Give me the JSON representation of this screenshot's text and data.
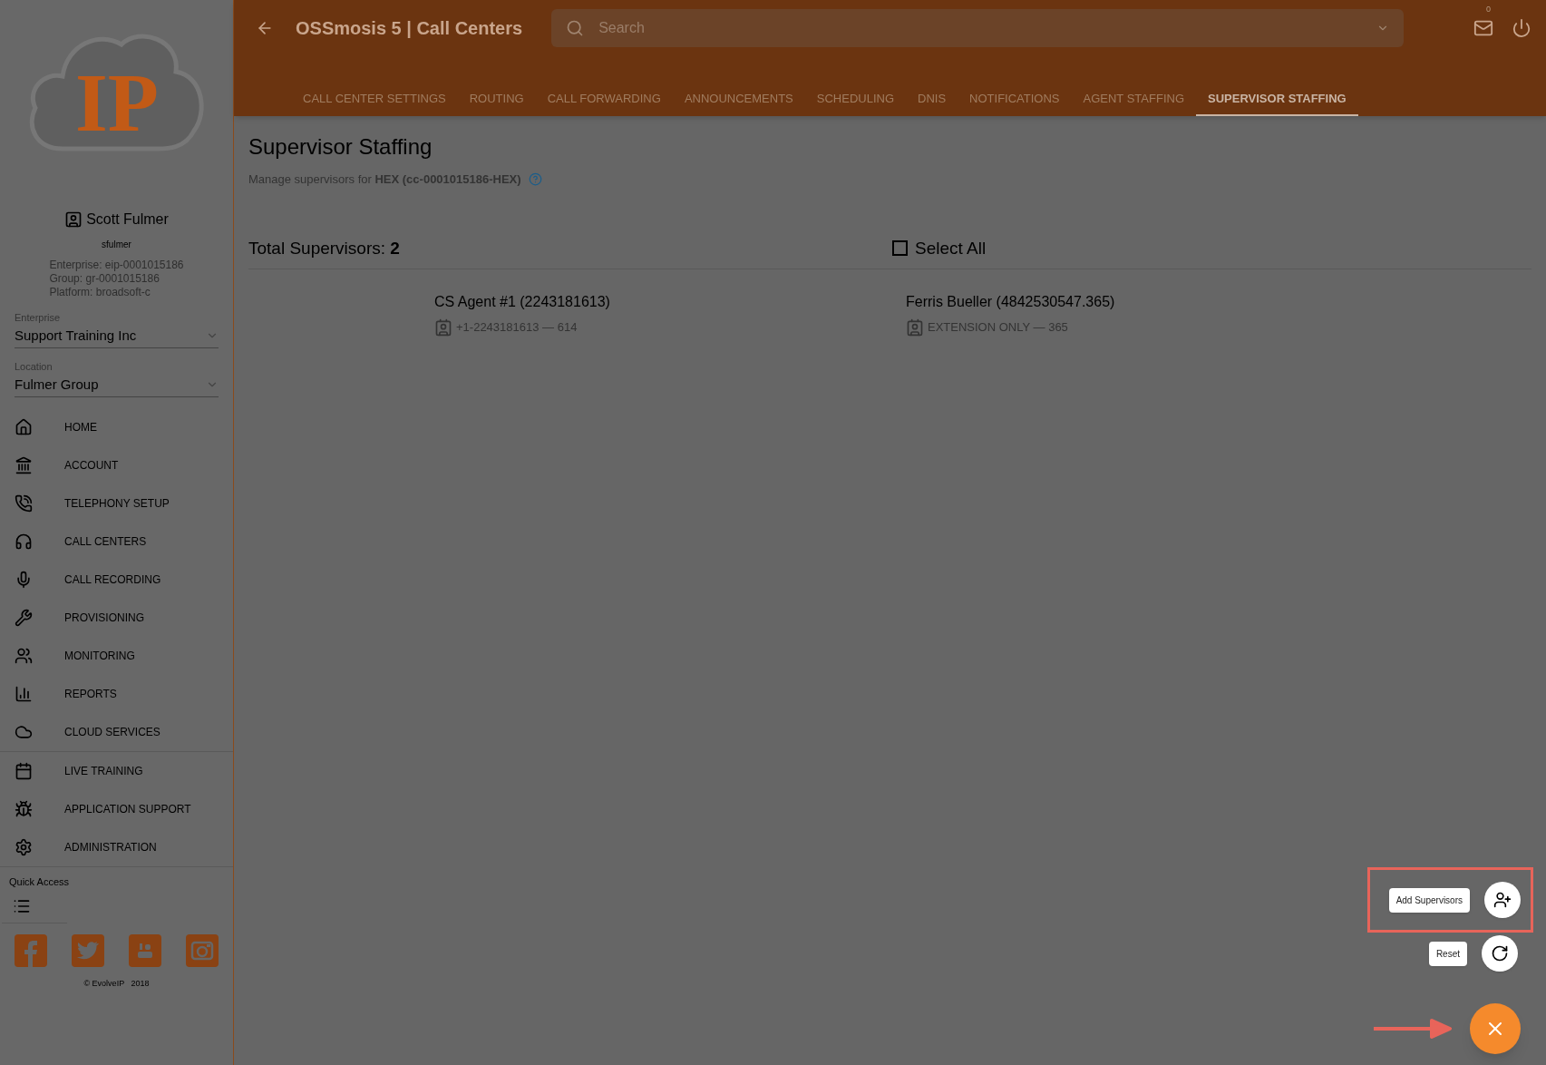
{
  "logo": {
    "text": "IP"
  },
  "user": {
    "name": "Scott Fulmer",
    "username": "sfulmer",
    "details": [
      "Enterprise: eip-0001015186",
      "Group: gr-0001015186",
      "Platform: broadsoft-c"
    ]
  },
  "selects": [
    {
      "label": "Enterprise",
      "value": "Support Training Inc"
    },
    {
      "label": "Location",
      "value": "Fulmer Group"
    }
  ],
  "nav": [
    {
      "label": "HOME"
    },
    {
      "label": "ACCOUNT"
    },
    {
      "label": "TELEPHONY SETUP"
    },
    {
      "label": "CALL CENTERS"
    },
    {
      "label": "CALL RECORDING"
    },
    {
      "label": "PROVISIONING"
    },
    {
      "label": "MONITORING"
    },
    {
      "label": "REPORTS"
    },
    {
      "label": "CLOUD SERVICES"
    },
    {
      "label": "LIVE TRAINING"
    },
    {
      "label": "APPLICATION SUPPORT"
    },
    {
      "label": "ADMINISTRATION"
    }
  ],
  "quick_access": {
    "label": "Quick Access"
  },
  "footer": {
    "copyright": "© EvolveIP   2018"
  },
  "header": {
    "title": "OSSmosis 5 | Call Centers",
    "search_placeholder": "Search",
    "mail_badge": "0"
  },
  "tabs": [
    {
      "label": "CALL CENTER SETTINGS",
      "selected": false
    },
    {
      "label": "ROUTING",
      "selected": false
    },
    {
      "label": "CALL FORWARDING",
      "selected": false
    },
    {
      "label": "ANNOUNCEMENTS",
      "selected": false
    },
    {
      "label": "SCHEDULING",
      "selected": false
    },
    {
      "label": "DNIS",
      "selected": false
    },
    {
      "label": "NOTIFICATIONS",
      "selected": false
    },
    {
      "label": "AGENT STAFFING",
      "selected": false
    },
    {
      "label": "SUPERVISOR STAFFING",
      "selected": true
    }
  ],
  "page": {
    "title": "Supervisor Staffing",
    "subtitle": "Manage supervisors for **HEX (cc-0001015186-HEX)**",
    "total": "Total Supervisors: **2**",
    "select_all": {
      "label": "Select All",
      "checked": false
    }
  },
  "supervisors": [
    {
      "name": "CS Agent #1 (2243181613)",
      "detail": "+1-2243181613 — 614"
    },
    {
      "name": "Ferris Bueller (4842530547.365)",
      "detail": "EXTENSION ONLY — 365"
    }
  ],
  "fab_actions": [
    {
      "label": "Add Supervisors",
      "kind": "add",
      "highlighted": true
    },
    {
      "label": "Reset",
      "kind": "reset",
      "highlighted": false
    }
  ]
}
